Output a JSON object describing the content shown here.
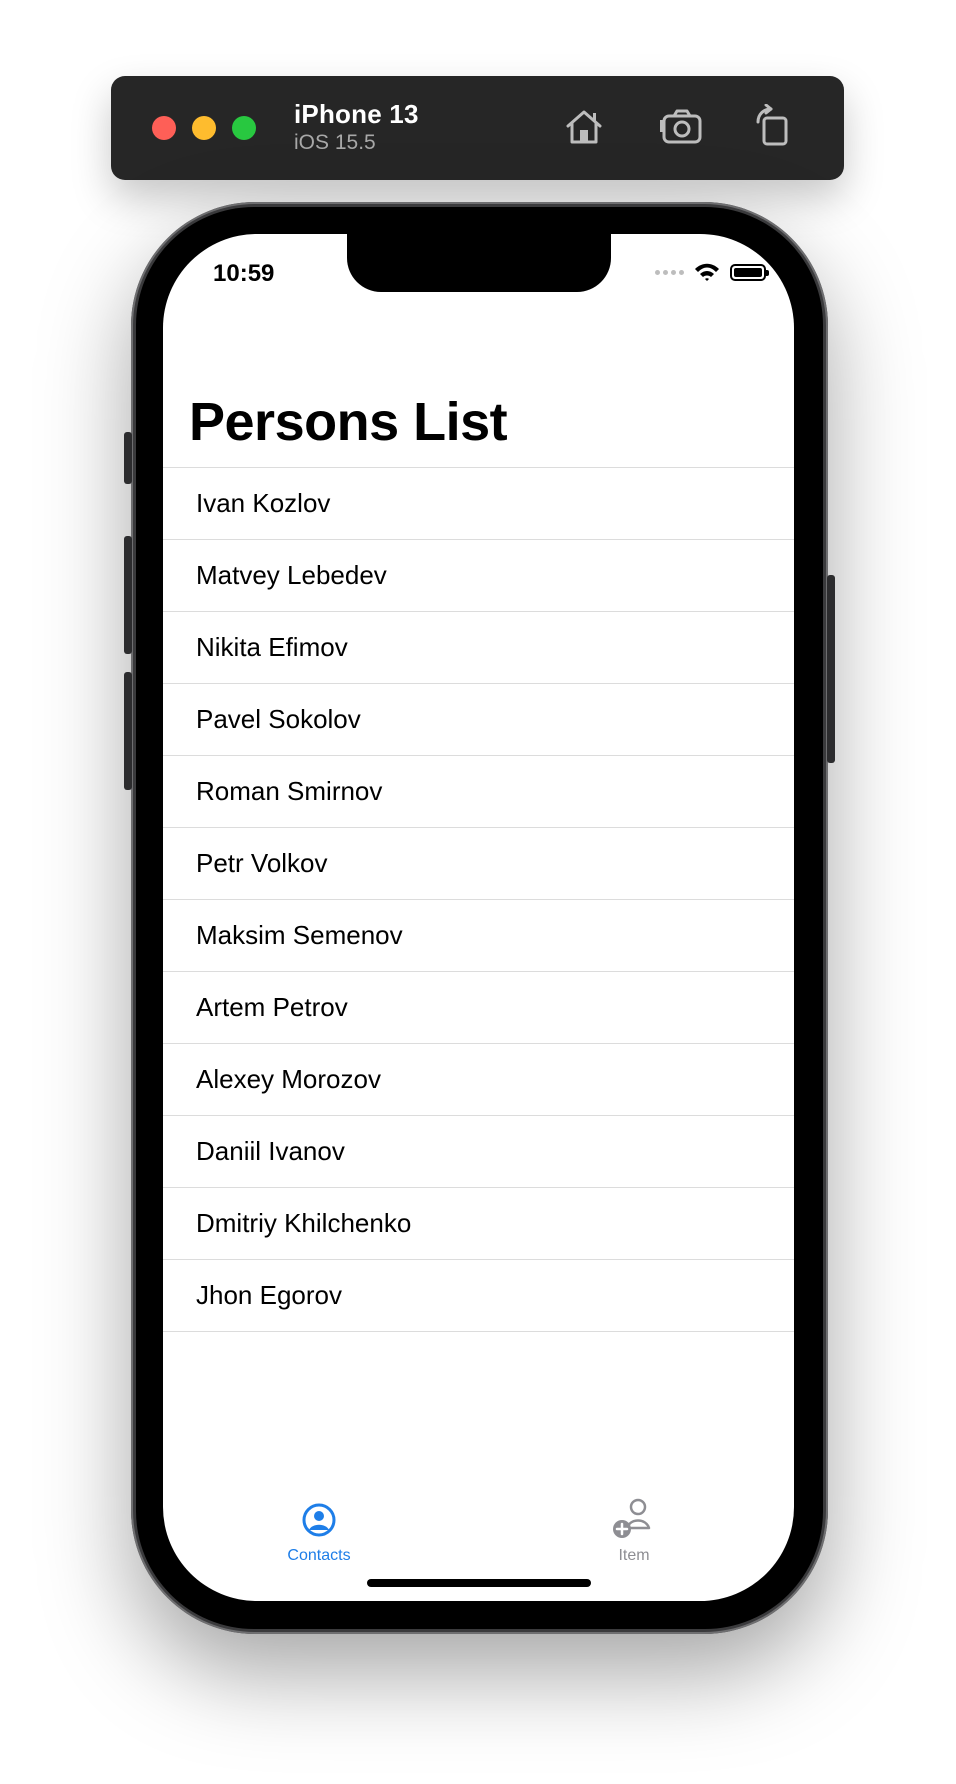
{
  "simulator": {
    "device_name": "iPhone 13",
    "os_version": "iOS 15.5",
    "toolbar_icons": [
      "home-icon",
      "screenshot-icon",
      "rotate-icon"
    ]
  },
  "status_bar": {
    "time": "10:59",
    "icons": [
      "cellular-signal-icon",
      "wifi-icon",
      "battery-icon"
    ]
  },
  "navigation": {
    "title": "Persons List"
  },
  "persons": [
    "Ivan Kozlov",
    "Matvey Lebedev",
    "Nikita Efimov",
    "Pavel Sokolov",
    "Roman Smirnov",
    "Petr Volkov",
    "Maksim Semenov",
    "Artem Petrov",
    "Alexey Morozov",
    "Daniil Ivanov",
    "Dmitriy Khilchenko",
    "Jhon Egorov"
  ],
  "tabbar": {
    "tabs": [
      {
        "label": "Contacts",
        "icon": "person-circle-icon",
        "active": true
      },
      {
        "label": "Item",
        "icon": "person-add-icon",
        "active": false
      }
    ]
  },
  "colors": {
    "accent": "#1e7ee8",
    "inactive_tab": "#8e8e93",
    "separator": "#dcdcdc",
    "toolbar_bg": "#262626"
  }
}
